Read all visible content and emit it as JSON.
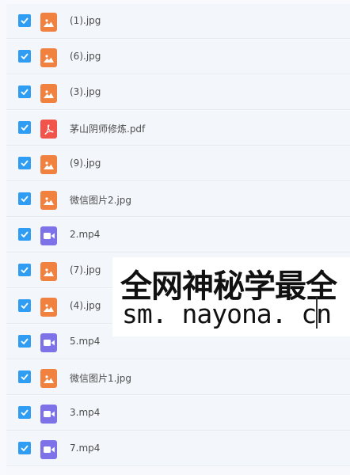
{
  "files": [
    {
      "name": "(1).jpg",
      "type": "img"
    },
    {
      "name": "(6).jpg",
      "type": "img"
    },
    {
      "name": "(3).jpg",
      "type": "img"
    },
    {
      "name": "茅山阴师修炼.pdf",
      "type": "pdf"
    },
    {
      "name": "(9).jpg",
      "type": "img"
    },
    {
      "name": "微信图片2.jpg",
      "type": "img"
    },
    {
      "name": "2.mp4",
      "type": "video"
    },
    {
      "name": "(7).jpg",
      "type": "img"
    },
    {
      "name": "(4).jpg",
      "type": "img"
    },
    {
      "name": "5.mp4",
      "type": "video"
    },
    {
      "name": "微信图片1.jpg",
      "type": "img"
    },
    {
      "name": "3.mp4",
      "type": "video"
    },
    {
      "name": "7.mp4",
      "type": "video"
    }
  ],
  "watermark": {
    "line1": "全网神秘学最全",
    "line2": "sm. nayona. cn"
  },
  "colors": {
    "checkbox": "#2f9df3",
    "image_icon": "#f0813e",
    "pdf_icon": "#f0544a",
    "video_icon": "#7d72e8"
  }
}
